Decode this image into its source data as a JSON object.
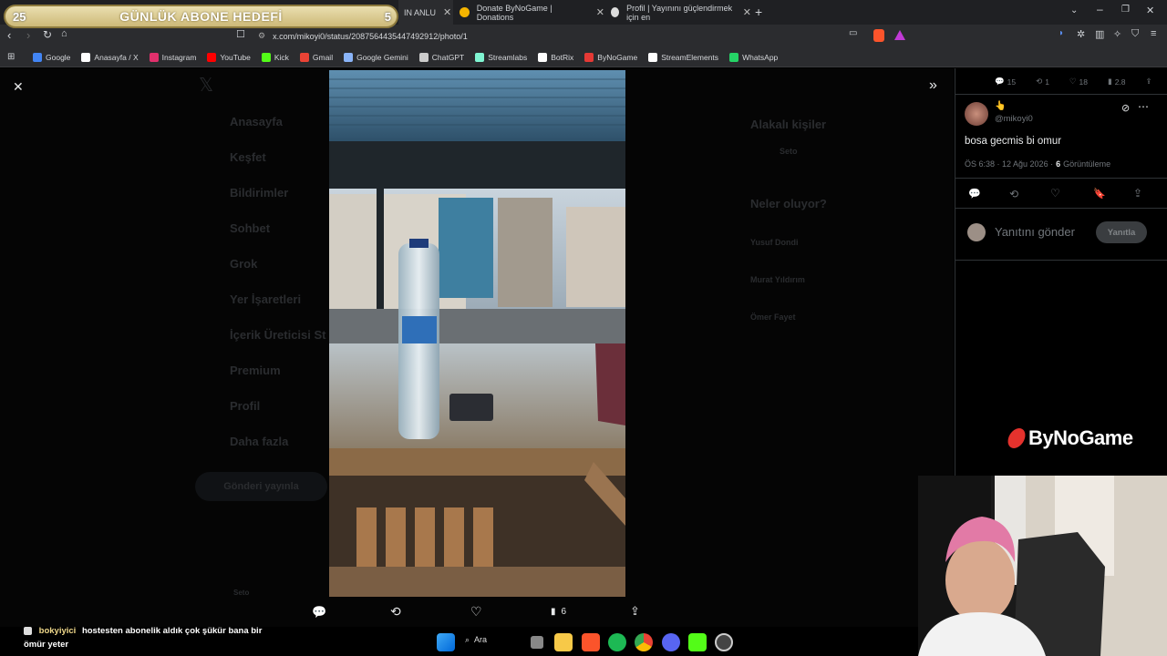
{
  "sub_goal": {
    "title": "GÜNLÜK ABONE HEDEFİ",
    "current": "25",
    "target": "5"
  },
  "tabs": [
    {
      "label": "IN ANLU",
      "active": true
    },
    {
      "label": "Donate ByNoGame | Donations",
      "active": false
    },
    {
      "label": "Profil | Yayınını güçlendirmek için en",
      "active": false
    }
  ],
  "address": {
    "url": "x.com/mikoyi0/status/2087564435447492912/photo/1"
  },
  "bookmarks": [
    "Google",
    "Anasayfa / X",
    "Instagram",
    "YouTube",
    "Kick",
    "Gmail",
    "Google Gemini",
    "ChatGPT",
    "Streamlabs",
    "BotRix",
    "ByNoGame",
    "StreamElements",
    "WhatsApp"
  ],
  "bookmark_colors": [
    "#4285f4",
    "#ffffff",
    "#e1306c",
    "#ff0000",
    "#53fc18",
    "#ea4335",
    "#8ab4f8",
    "#cccccc",
    "#80f5d2",
    "#ffffff",
    "#e53935",
    "#ffffff",
    "#25d366"
  ],
  "sidebar_ghost": [
    "Anasayfa",
    "Keşfet",
    "Bildirimler",
    "Sohbet",
    "Grok",
    "Yer İşaretleri",
    "İçerik Üreticisi St",
    "Premium",
    "Profil",
    "Daha fazla"
  ],
  "post_button_ghost": "Gönderi yayınla",
  "ghost_right": {
    "who_to_follow": "Alakalı kişiler",
    "whats_happening": "Neler oluyor?",
    "names": [
      "Seto",
      "Yusuf Dondi",
      "Murat Yıldırım",
      "Ömer Fayet"
    ],
    "bottom_name": "Seto"
  },
  "stats_top": {
    "replies": "15",
    "reposts": "1",
    "likes": "18",
    "views": "2.8"
  },
  "tweet": {
    "handle": "@mikoyi0",
    "text": "bosa gecmis bi omur",
    "time": "ÖS 6:38 · 12 Ağu 2026 ·",
    "views": "6",
    "views_label": "Görüntüleme"
  },
  "reply": {
    "placeholder": "Yanıtını gönder",
    "button": "Yanıtla"
  },
  "photo_actions": {
    "views": "6"
  },
  "brand": "ByNoGame",
  "chat": {
    "user": "bokyiyici",
    "message": "hostesten abonelik aldık çok şükür bana bir ömür yeter"
  },
  "taskbar": {
    "search": "Ara"
  }
}
